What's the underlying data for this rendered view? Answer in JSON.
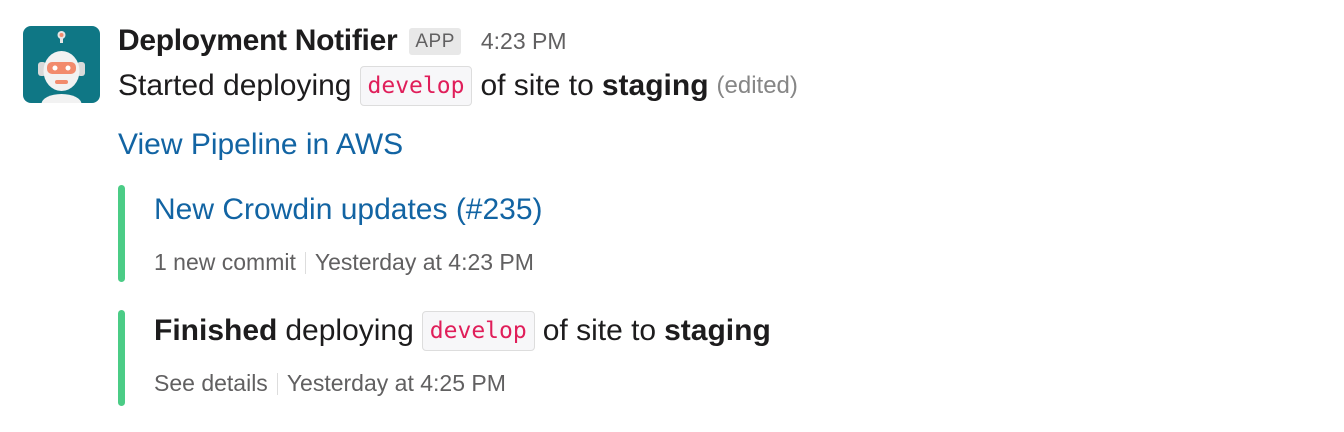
{
  "message": {
    "sender": "Deployment Notifier",
    "badge": "APP",
    "time": "4:23 PM",
    "text_prefix": "Started deploying",
    "code": "develop",
    "text_middle": "of site to",
    "text_bold": "staging",
    "edited": "(edited)",
    "link": "View Pipeline in AWS"
  },
  "attachments": [
    {
      "title_link": "New Crowdin updates (#235)",
      "footer_left": "1 new commit",
      "footer_right": "Yesterday at 4:23 PM",
      "color": "#4bcc86"
    },
    {
      "title_bold": "Finished",
      "title_text": "deploying",
      "code": "develop",
      "title_middle": "of site to",
      "title_bold2": "staging",
      "footer_left": "See details",
      "footer_right": "Yesterday at 4:25 PM",
      "color": "#4bcc86"
    }
  ],
  "colors": {
    "avatar_bg": "#0f7785",
    "link": "#1264a3",
    "code_text": "#e01e5a"
  },
  "icons": {
    "avatar": "robot-icon"
  }
}
